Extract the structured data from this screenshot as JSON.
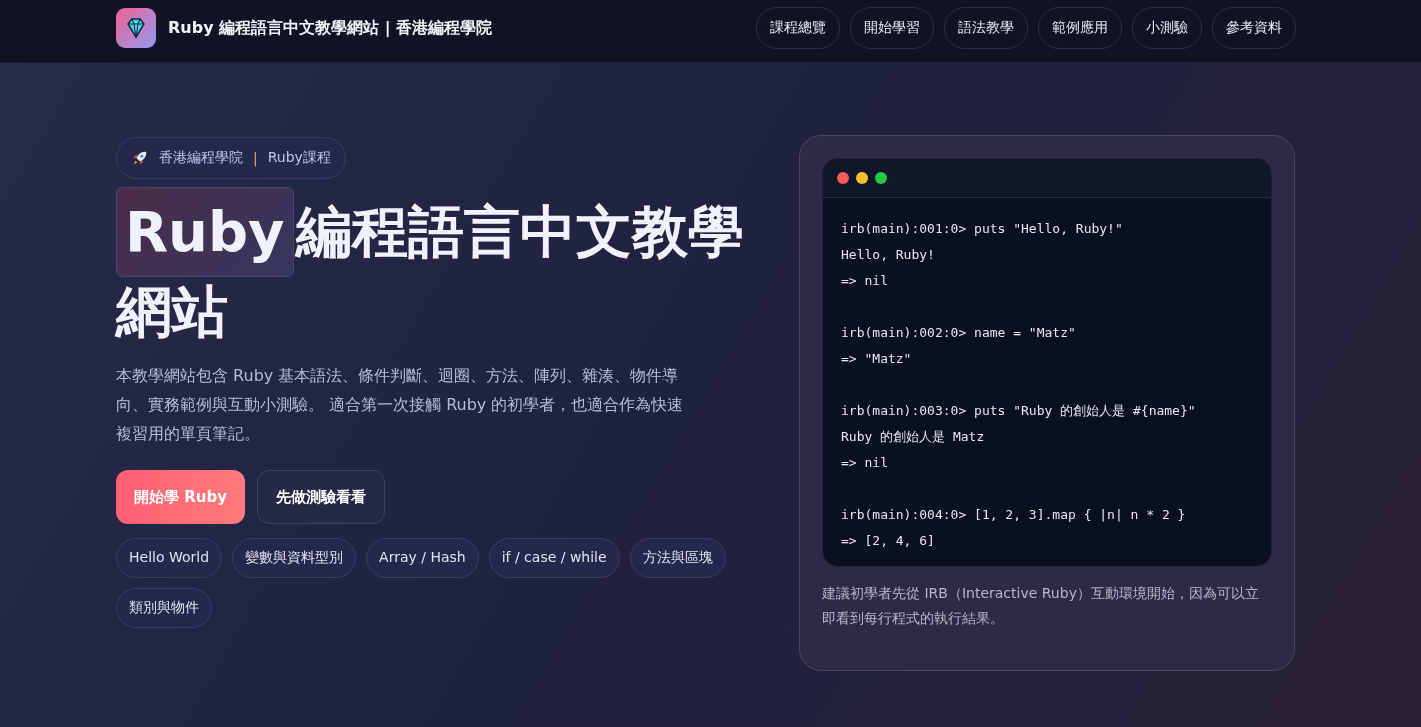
{
  "header": {
    "site_title": "Ruby 編程語言中文教學網站 | 香港編程學院",
    "nav": [
      {
        "label": "課程總覽"
      },
      {
        "label": "開始學習"
      },
      {
        "label": "語法教學"
      },
      {
        "label": "範例應用"
      },
      {
        "label": "小測驗"
      },
      {
        "label": "參考資料"
      }
    ]
  },
  "hero": {
    "badge": {
      "school": "香港編程學院",
      "separator": "|",
      "course": "Ruby課程"
    },
    "title_highlight": "Ruby",
    "title_rest": [
      "編程語言中文教學",
      "網站"
    ],
    "description": "本教學網站包含 Ruby 基本語法、條件判斷、迴圈、方法、陣列、雜湊、物件導向、實務範例與互動小測驗。 適合第一次接觸 Ruby 的初學者，也適合作為快速複習用的單頁筆記。",
    "buttons": [
      {
        "label": "開始學 Ruby",
        "kind": "primary"
      },
      {
        "label": "先做測驗看看",
        "kind": "secondary"
      }
    ],
    "tags": [
      "Hello World",
      "變數與資料型別",
      "Array / Hash",
      "if / case / while",
      "方法與區塊",
      "類別與物件"
    ]
  },
  "terminal": {
    "blocks": [
      {
        "lines": [
          "irb(main):001:0> puts \"Hello, Ruby!\"",
          "Hello, Ruby!",
          "=> nil"
        ]
      },
      {
        "lines": [
          "irb(main):002:0> name = \"Matz\"",
          "=> \"Matz\""
        ]
      },
      {
        "lines": [
          "irb(main):003:0> puts \"Ruby 的創始人是 #{name}\"",
          "Ruby 的創始人是 Matz",
          "=> nil"
        ]
      },
      {
        "lines": [
          "irb(main):004:0> [1, 2, 3].map { |n| n * 2 }",
          "=> [2, 4, 6]"
        ]
      }
    ],
    "caption": "建議初學者先從 IRB（Interactive Ruby）互動環境開始，因為可以立即看到每行程式的執行結果。"
  }
}
